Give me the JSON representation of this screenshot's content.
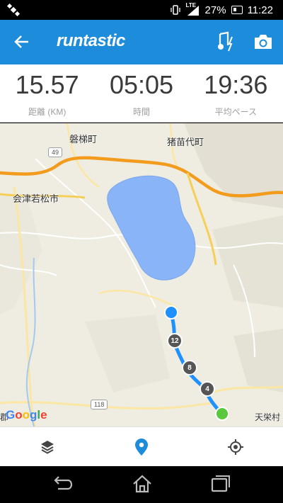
{
  "status_bar": {
    "lte": "LTE",
    "battery_percent": "27%",
    "time": "11:22"
  },
  "app_bar": {
    "logo_text": "runtastic",
    "accent_color": "#1d8ddb"
  },
  "stats": [
    {
      "value": "15.57",
      "label": "距離 (KM)"
    },
    {
      "value": "05:05",
      "label": "時間"
    },
    {
      "value": "19:36",
      "label": "平均ペース"
    }
  ],
  "map": {
    "labels": {
      "bandai": "磐梯町",
      "inawashiro": "猪苗代町",
      "aizuwakamatsu": "会津若松市",
      "tenei": "天栄村",
      "left_edge": "郡"
    },
    "road_shields": {
      "r49": "49",
      "r118": "118"
    },
    "route_markers": [
      "12",
      "8",
      "4"
    ],
    "google_logo": [
      "G",
      "o",
      "o",
      "g",
      "l",
      "e"
    ]
  },
  "toolbar": {
    "icons": [
      "layers-icon",
      "location-pin-icon",
      "my-location-icon"
    ],
    "active_color": "#1d8ddb"
  },
  "navbar": {
    "icons": [
      "back-icon",
      "home-icon",
      "recent-apps-icon"
    ]
  }
}
